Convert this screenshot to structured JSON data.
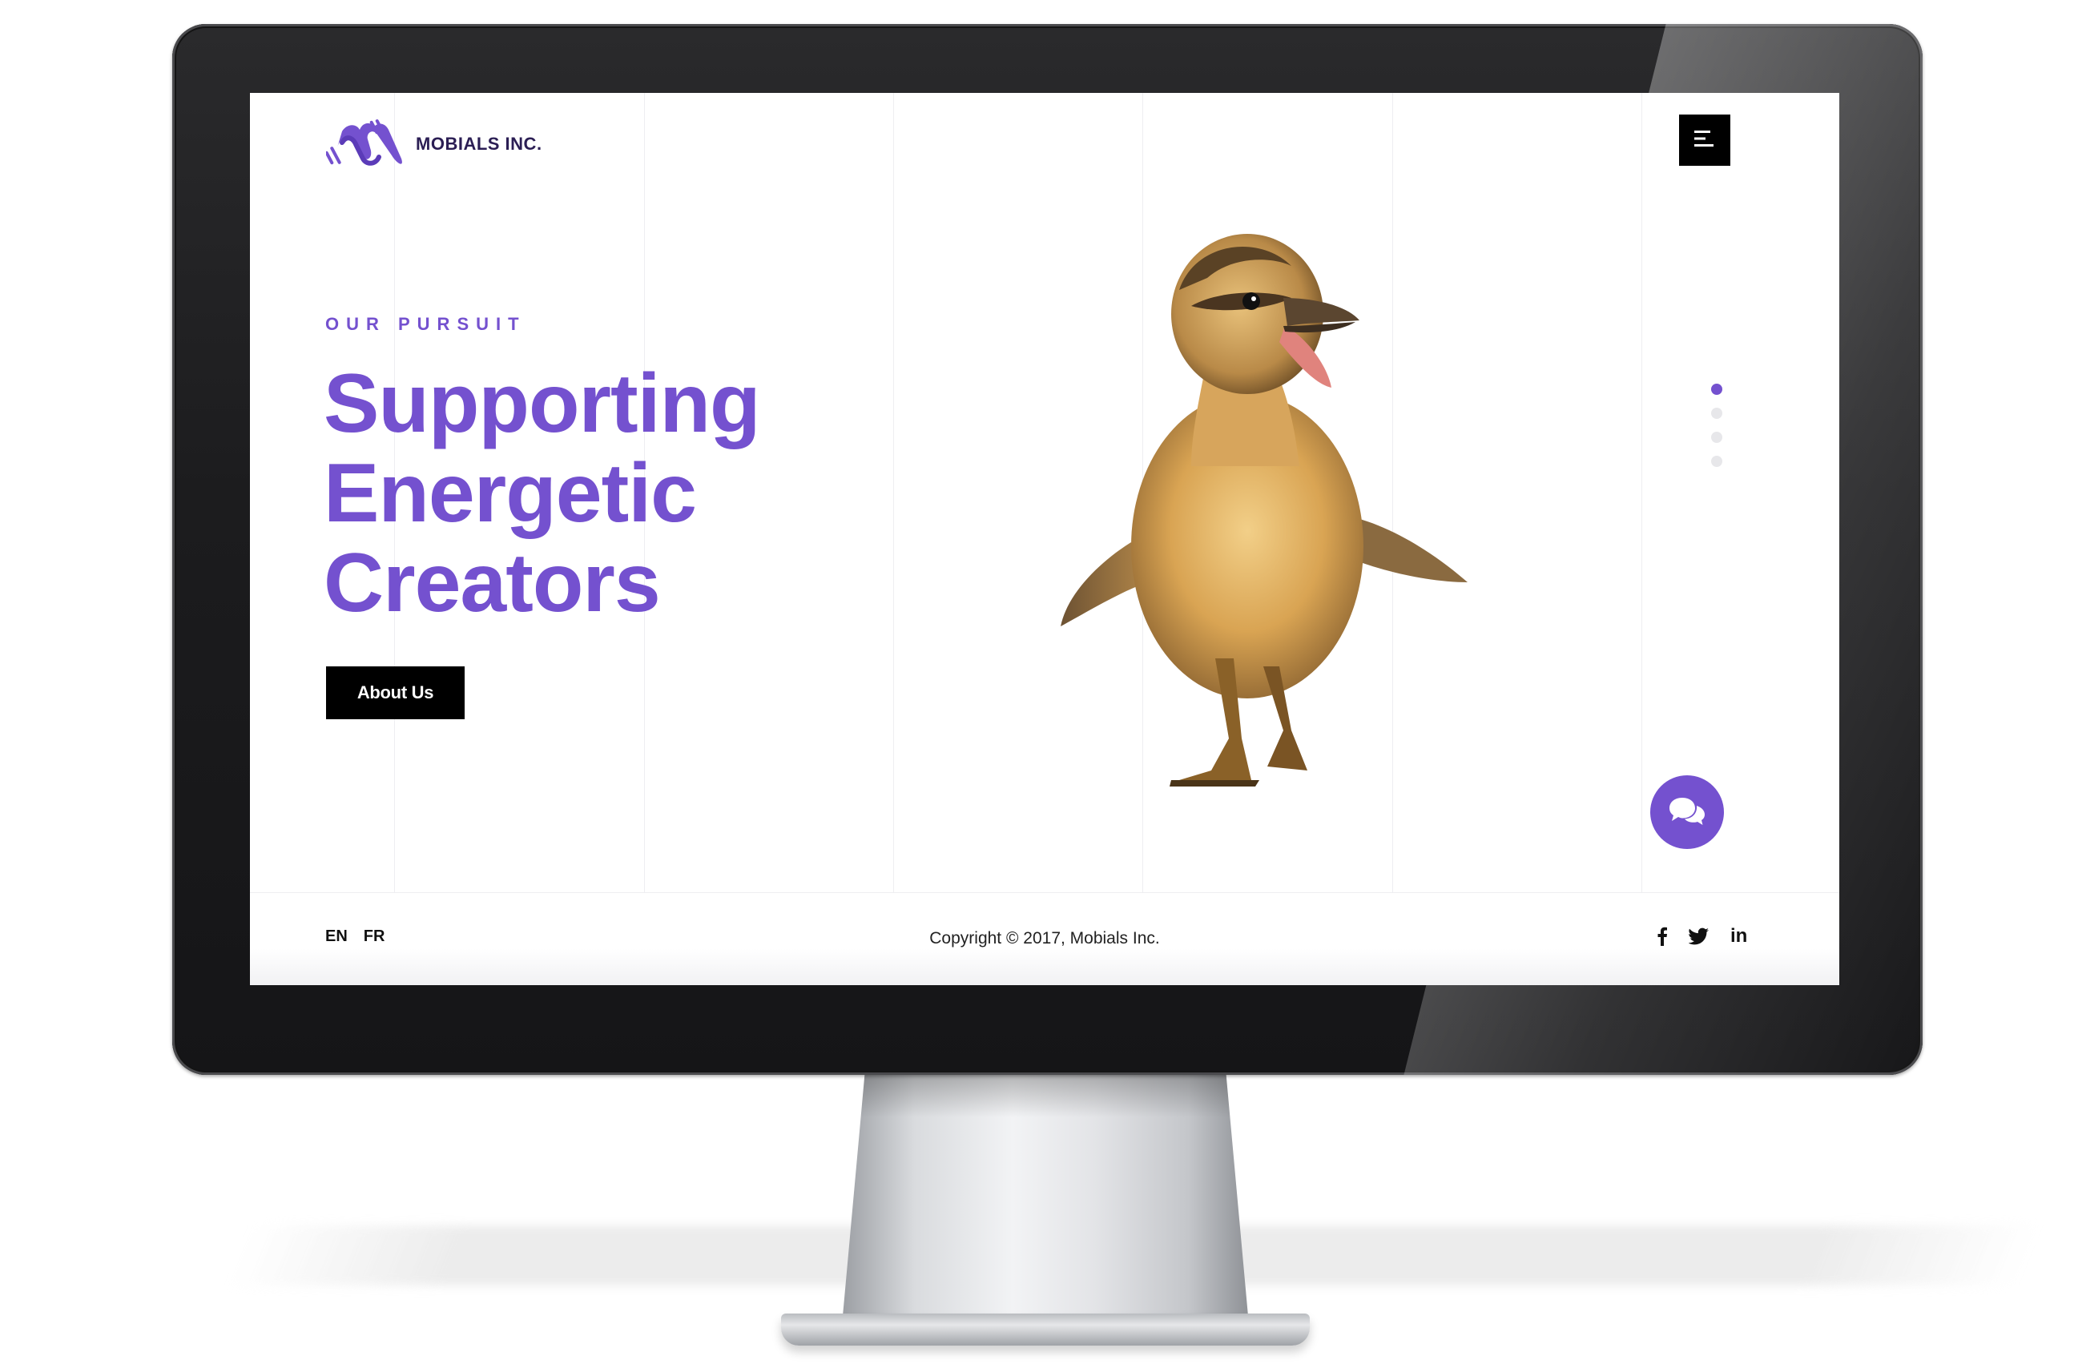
{
  "brand": {
    "name": "MOBIALS INC.",
    "accent_color": "#7451cf",
    "logo_icon": "mobials-m-logo"
  },
  "header": {
    "menu_icon": "hamburger-menu-icon"
  },
  "hero": {
    "eyebrow": "OUR PURSUIT",
    "headline_lines": [
      "Supporting",
      "Energetic",
      "Creators"
    ],
    "cta_label": "About Us",
    "image": "duckling-photo"
  },
  "slider": {
    "dots": 4,
    "active_index": 0
  },
  "chat": {
    "icon": "chat-bubbles-icon"
  },
  "footer": {
    "languages": [
      "EN",
      "FR"
    ],
    "copyright": "Copyright © 2017, Mobials Inc.",
    "social": [
      {
        "name": "facebook",
        "glyph": "f"
      },
      {
        "name": "twitter",
        "glyph": "twitter-bird"
      },
      {
        "name": "linkedin",
        "glyph": "in"
      }
    ]
  }
}
